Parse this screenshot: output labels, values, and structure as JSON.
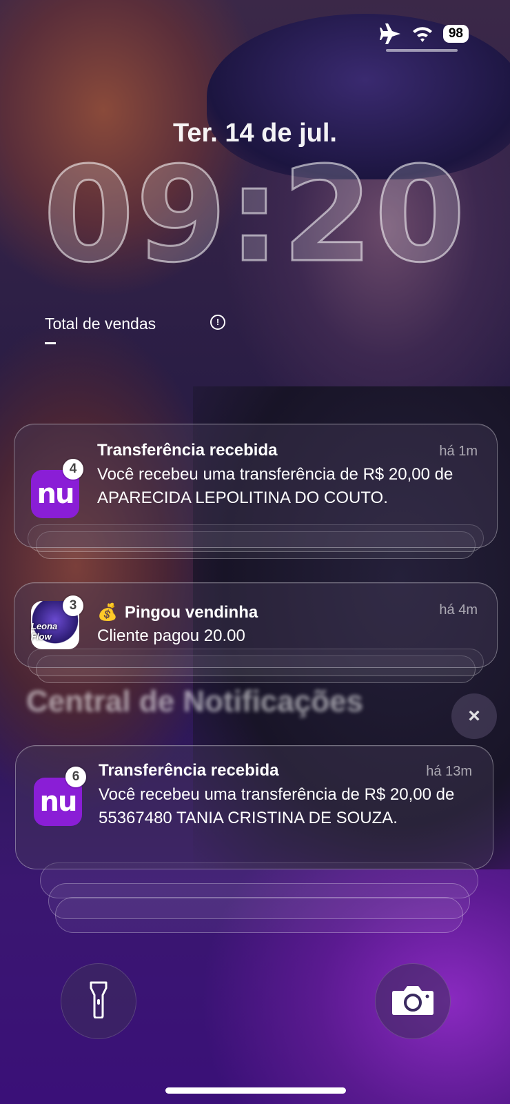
{
  "status_bar": {
    "battery": "98"
  },
  "lock": {
    "date": "Ter. 14 de jul.",
    "time": "09:20"
  },
  "widget": {
    "title": "Total de vendas",
    "info": "!"
  },
  "notifications": [
    {
      "app": "nu",
      "count": "4",
      "title": "Transferência recebida",
      "time": "há 1m",
      "body": "Você recebeu uma transferência de R$ 20,00 de APARECIDA LEPOLITINA DO COUTO."
    },
    {
      "app": "Leona Flow",
      "count": "3",
      "emoji": "💰",
      "title": "Pingou vendinha",
      "time": "há 4m",
      "body": "Cliente pagou 20.00"
    }
  ],
  "notification_center": {
    "title": "Central de Notificações",
    "close": "×",
    "items": [
      {
        "app": "nu",
        "count": "6",
        "title": "Transferência recebida",
        "time": "há 13m",
        "body": "Você recebeu uma transferência de R$ 20,00 de 55367480 TANIA CRISTINA DE SOUZA."
      }
    ]
  }
}
